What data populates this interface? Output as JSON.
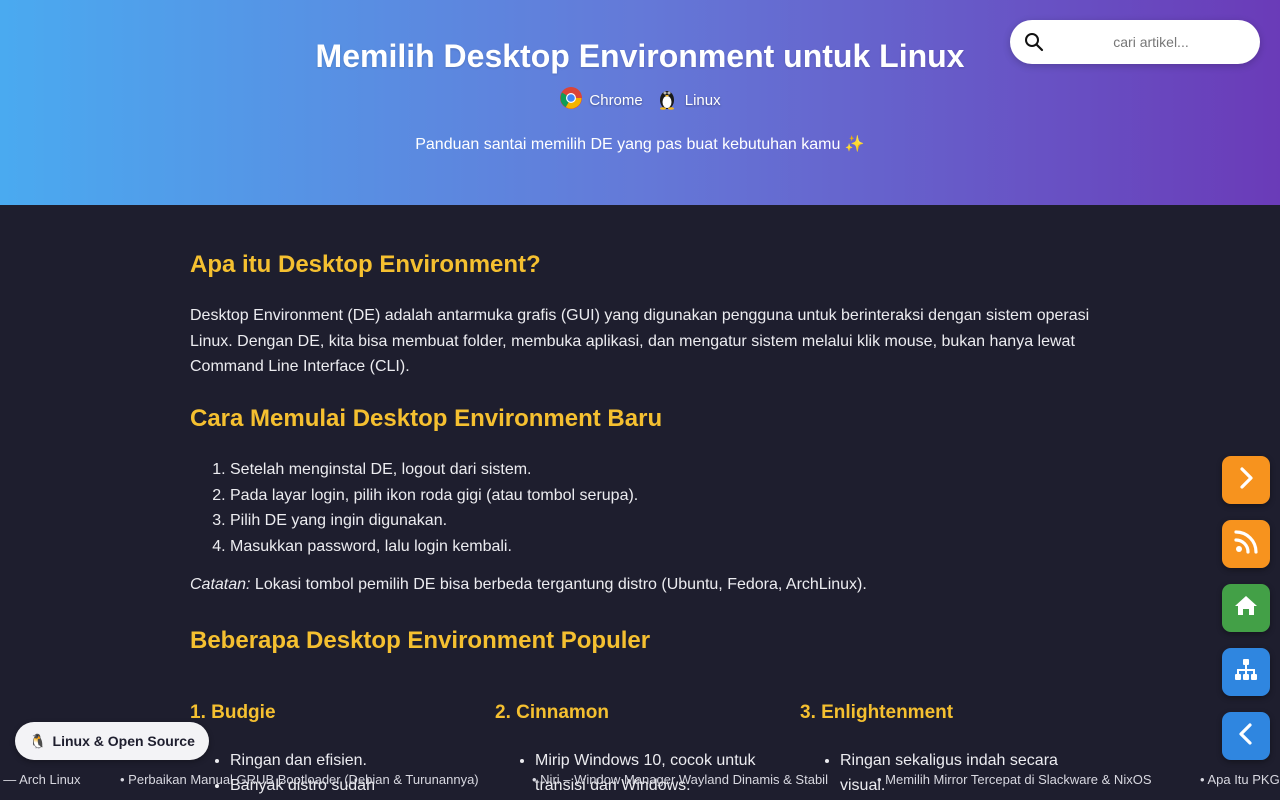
{
  "header": {
    "title": "Memilih Desktop Environment untuk Linux",
    "tags": [
      {
        "icon": "chrome-icon",
        "label": "Chrome"
      },
      {
        "icon": "tux-icon",
        "label": "Linux"
      }
    ],
    "subtitle": "Panduan santai memilih DE yang pas buat kebutuhan kamu ✨"
  },
  "search": {
    "placeholder": "cari artikel..."
  },
  "article": {
    "section1": {
      "heading": "Apa itu Desktop Environment?",
      "paragraph": "Desktop Environment (DE) adalah antarmuka grafis (GUI) yang digunakan pengguna untuk berinteraksi dengan sistem operasi Linux. Dengan DE, kita bisa membuat folder, membuka aplikasi, dan mengatur sistem melalui klik mouse, bukan hanya lewat Command Line Interface (CLI)."
    },
    "section2": {
      "heading": "Cara Memulai Desktop Environment Baru",
      "steps": [
        "Setelah menginstal DE, logout dari sistem.",
        "Pada layar login, pilih ikon roda gigi (atau tombol serupa).",
        "Pilih DE yang ingin digunakan.",
        "Masukkan password, lalu login kembali."
      ],
      "note_label": "Catatan:",
      "note_text": " Lokasi tombol pemilih DE bisa berbeda tergantung distro (Ubuntu, Fedora, ArchLinux)."
    },
    "section3": {
      "heading": "Beberapa Desktop Environment Populer",
      "items": [
        {
          "title": "1. Budgie",
          "points": [
            "Ringan dan efisien.",
            "Banyak distro sudah"
          ]
        },
        {
          "title": "2. Cinnamon",
          "points": [
            "Mirip Windows 10, cocok untuk transisi dari Windows."
          ]
        },
        {
          "title": "3. Enlightenment",
          "points": [
            "Ringan sekaligus indah secara visual."
          ]
        }
      ]
    }
  },
  "ticker": [
    "t — Arch Linux",
    "• Perbaikan Manual GRUB Bootloader (Debian & Turunannya)",
    "• Niri – Window Manager Wayland Dinamis & Stabil",
    "• Memilih Mirror Tercepat di Slackware & NixOS",
    "• Apa Itu PKG"
  ],
  "badge": {
    "icon": "🐧",
    "label": "Linux & Open Source"
  },
  "fabs": [
    {
      "icon": "chevron-right-icon",
      "color": "#f7931e"
    },
    {
      "icon": "rss-icon",
      "color": "#f7931e"
    },
    {
      "icon": "home-icon",
      "color": "#43a047"
    },
    {
      "icon": "sitemap-icon",
      "color": "#2f86e0"
    },
    {
      "icon": "chevron-left-icon",
      "color": "#2f86e0"
    }
  ]
}
